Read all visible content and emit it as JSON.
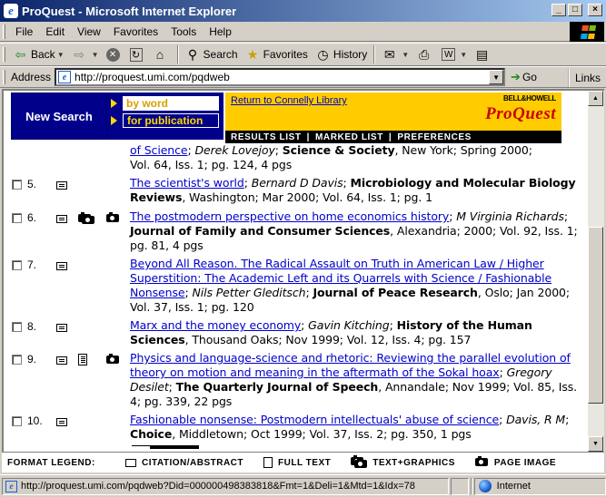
{
  "window": {
    "title": "ProQuest - Microsoft Internet Explorer",
    "min": "_",
    "max": "□",
    "close": "×"
  },
  "menu": [
    "File",
    "Edit",
    "View",
    "Favorites",
    "Tools",
    "Help"
  ],
  "toolbar": {
    "back": "Back",
    "search": "Search",
    "favorites": "Favorites",
    "history": "History"
  },
  "address": {
    "label": "Address",
    "url": "http://proquest.umi.com/pqdweb",
    "go": "Go",
    "links": "Links"
  },
  "header": {
    "new_search": "New Search",
    "by_word": "by word",
    "for_publication": "for publication",
    "return_link": "Return to Connelly Library",
    "bh_logo": "BELL&HOWELL",
    "pq_logo": "ProQuest",
    "nav": [
      "RESULTS LIST",
      "MARKED LIST",
      "PREFERENCES"
    ]
  },
  "partial_top": {
    "link_tail": "of Science",
    "author": "Derek Lovejoy",
    "journal": "Science & Society",
    "rest1": ", New York; Spring 2000;",
    "line2": "Vol. 64, Iss. 1; pg. 124, 4 pgs"
  },
  "results": [
    {
      "num": "5.",
      "title": "The scientist's world",
      "author": "Bernard D Davis",
      "journal": "Microbiology and Molecular Biology Reviews",
      "rest": ", Washington; Mar 2000; Vol. 64, Iss. 1; pg. 1"
    },
    {
      "num": "6.",
      "title": "The postmodern perspective on home economics history",
      "author": "M Virginia Richards",
      "journal": "Journal of Family and Consumer Sciences",
      "rest": ", Alexandria; 2000; Vol. 92, Iss. 1; pg. 81, 4 pgs"
    },
    {
      "num": "7.",
      "title": "Beyond All Reason. The Radical Assault on Truth in American Law / Higher Superstition: The Academic Left and its Quarrels with Science / Fashionable Nonsense",
      "author": "Nils Petter Gleditsch",
      "journal": "Journal of Peace Research",
      "rest": ", Oslo; Jan 2000; Vol. 37, Iss. 1; pg. 120"
    },
    {
      "num": "8.",
      "title": "Marx and the money economy",
      "author": "Gavin Kitching",
      "journal": "History of the Human Sciences",
      "rest": ", Thousand Oaks; Nov 1999; Vol. 12, Iss. 4; pg. 157"
    },
    {
      "num": "9.",
      "title": "Physics and language-science and rhetoric: Reviewing the parallel evolution of theory on motion and meaning in the aftermath of the Sokal hoax",
      "author": "Gregory Desilet",
      "journal": "The Quarterly Journal of Speech",
      "rest": ", Annandale; Nov 1999; Vol. 85, Iss. 4; pg. 339, 22 pgs"
    },
    {
      "num": "10.",
      "title": "Fashionable nonsense: Postmodern intellectuals' abuse of science",
      "author": "Davis, R M",
      "journal": "Choice",
      "rest": ", Middletown; Oct 1999; Vol. 37, Iss. 2; pg. 350, 1 pgs"
    }
  ],
  "legend": {
    "title": "FORMAT LEGEND:",
    "citation": "CITATION/ABSTRACT",
    "full_text": "FULL TEXT",
    "text_graphics": "TEXT+GRAPHICS",
    "page_image": "PAGE IMAGE"
  },
  "status": {
    "url": "http://proquest.umi.com/pqdweb?Did=000000498383818&Fmt=1&Deli=1&Mtd=1&Idx=78",
    "zone": "Internet"
  }
}
